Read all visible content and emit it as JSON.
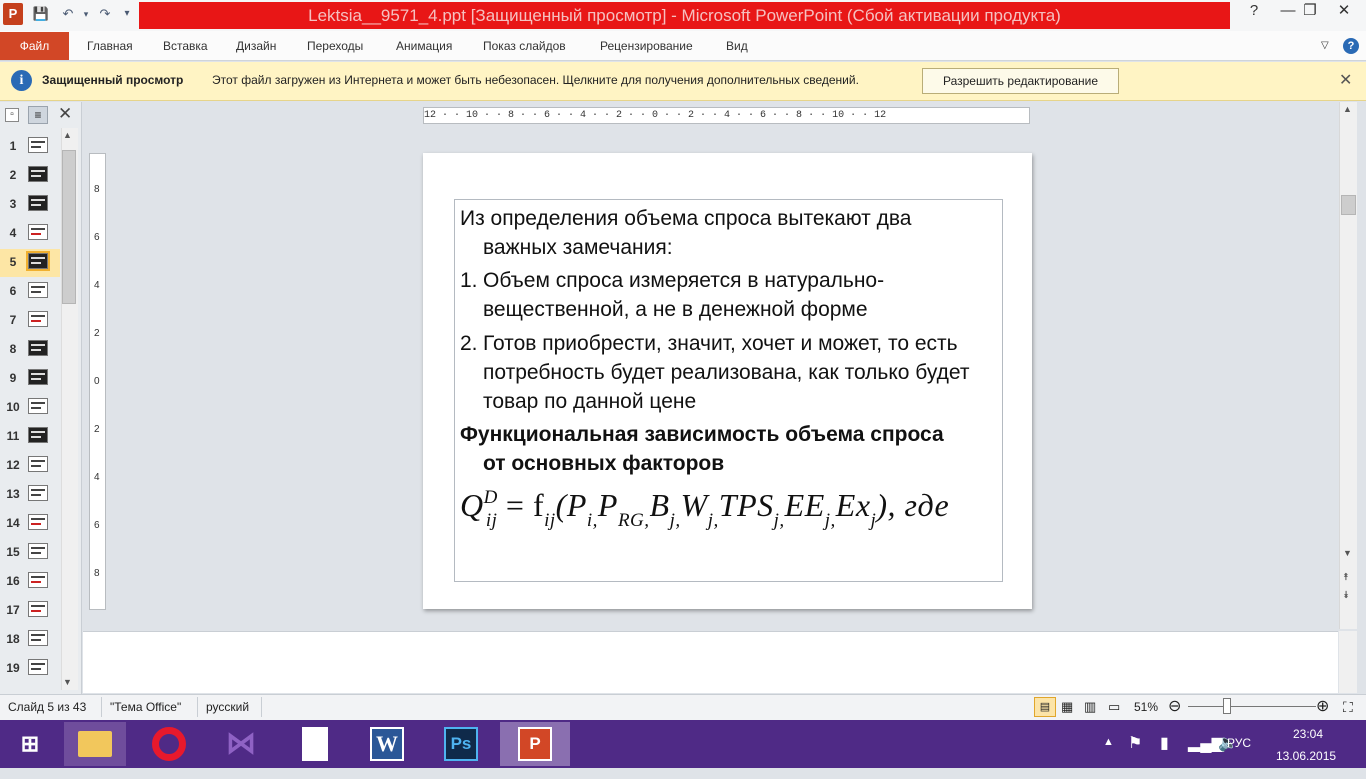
{
  "titlebar": {
    "app_icon": "P",
    "title": "Lektsia__9571_4.ppt [Защищенный просмотр]  -  Microsoft PowerPoint (Сбой активации продукта)",
    "minimize": "—",
    "restore": "❐",
    "close": "✕"
  },
  "ribbon": {
    "file": "Файл",
    "tabs": [
      "Главная",
      "Вставка",
      "Дизайн",
      "Переходы",
      "Анимация",
      "Показ слайдов",
      "Рецензирование",
      "Вид"
    ]
  },
  "message_bar": {
    "title": "Защищенный просмотр",
    "text": "Этот файл загружен из Интернета и может быть небезопасен. Щелкните для получения дополнительных сведений.",
    "button": "Разрешить редактирование",
    "close": "✕"
  },
  "slides_panel": {
    "numbers": [
      "1",
      "2",
      "3",
      "4",
      "5",
      "6",
      "7",
      "8",
      "9",
      "10",
      "11",
      "12",
      "13",
      "14",
      "15",
      "16",
      "17",
      "18",
      "19"
    ],
    "selected": "5"
  },
  "ruler": {
    "h_text": "12 · · 10 · · 8 · · 6 · · 4 · · 2 · · 0 · · 2 · · 4 · · 6 · · 8 · · 10 · · 12"
  },
  "slide": {
    "intro": "Из определения объема спроса вытекают два важных замечания:",
    "item1_num": "1.",
    "item1": "Объем спроса измеряется в натурально-вещественной, а не в денежной форме",
    "item2_num": "2.",
    "item2": "Готов приобрести, значит, хочет и может, то есть потребность будет реализована, как только будет товар по данной цене",
    "heading": "Функциональная зависимость объема спроса от основных факторов",
    "formula": {
      "q": "Q",
      "q_sub": "ij",
      "q_sup": "D",
      "eq": " = f",
      "f_sub": "ij",
      "open": "(P",
      "p1_sub": "i,",
      "p2": "P",
      "p2_sub": "RG,",
      "b": "B",
      "b_sub": "j,",
      "w": "W",
      "w_sub": "j,",
      "tps": "TPS",
      "tps_sub": "j,",
      "ee": "EE",
      "ee_sub": "j,",
      "ex": "Ex",
      "ex_sub": "j",
      "close": "), где"
    }
  },
  "statusbar": {
    "slide": "Слайд 5 из 43",
    "theme": "\"Тема Office\"",
    "lang": "русский",
    "zoom": "51%",
    "zoom_level": 0.51
  },
  "taskbar": {
    "lang": "РУС",
    "time": "23:04",
    "date": "13.06.2015"
  },
  "colors": {
    "title_red": "#e81616",
    "file_tab": "#d24726",
    "message_bar": "#fff4c4",
    "taskbar": "#4f2a86"
  }
}
